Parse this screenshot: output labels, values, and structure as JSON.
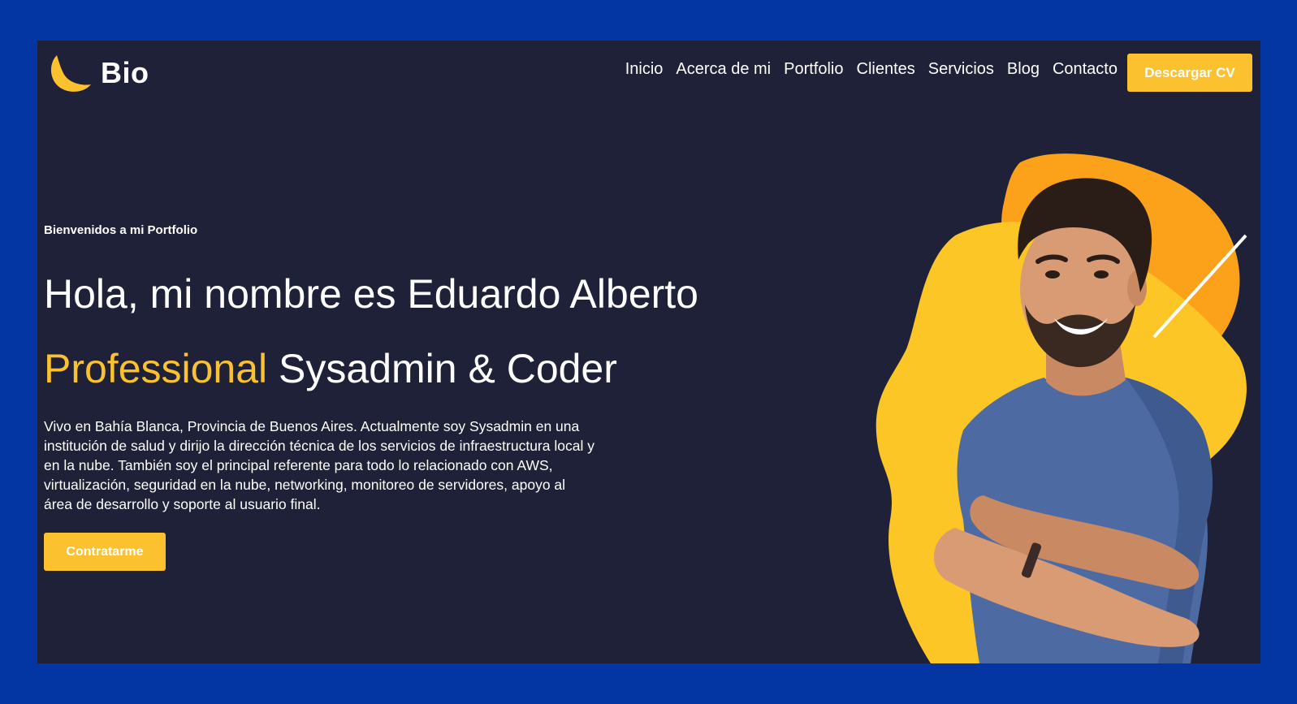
{
  "brand": {
    "logo_text": "Bio",
    "accent_color": "#fcc12e",
    "background_color": "#1e2137",
    "page_background": "#0336a2"
  },
  "nav": {
    "items": [
      {
        "label": "Inicio"
      },
      {
        "label": "Acerca de mi"
      },
      {
        "label": "Portfolio"
      },
      {
        "label": "Clientes"
      },
      {
        "label": "Servicios"
      },
      {
        "label": "Blog"
      },
      {
        "label": "Contacto"
      }
    ],
    "cta_label": "Descargar CV"
  },
  "hero": {
    "welcome": "Bienvenidos a mi Portfolio",
    "headline": "Hola, mi nombre es Eduardo Alberto",
    "subheadline_accent": "Professional",
    "subheadline_rest": " Sysadmin & Coder",
    "bio": "Vivo en Bahía Blanca, Provincia de Buenos Aires. Actualmente soy Sysadmin en una institución de salud y dirijo la dirección técnica de los servicios de infraestructura local y en la nube. También soy el principal referente para todo lo relacionado con AWS, virtualización, seguridad en la nube, networking, monitoreo de servidores, apoyo al área de desarrollo y soporte al usuario final.",
    "cta_label": "Contratarme"
  },
  "icons": {
    "logo": "crescent-logo-icon",
    "portrait": "smiling-man-portrait"
  }
}
